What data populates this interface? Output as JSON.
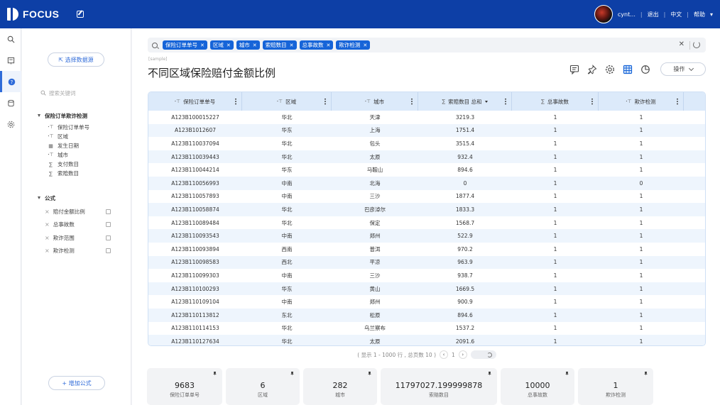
{
  "topbar": {
    "logo_text": "FOCUS",
    "username": "cynt...",
    "logout": "退出",
    "language": "中文",
    "help": "帮助"
  },
  "panel": {
    "select_source": "⇱ 选择数据源",
    "search_placeholder": "搜索关键词",
    "table_name": "保险订单欺诈检测",
    "fields": [
      {
        "icon": "text-field-icon",
        "label": "保险订单单号"
      },
      {
        "icon": "text-field-icon",
        "label": "区域"
      },
      {
        "icon": "date-field-icon",
        "label": "发生日期"
      },
      {
        "icon": "text-field-icon",
        "label": "城市"
      },
      {
        "icon": "number-field-icon",
        "label": "支付数目"
      },
      {
        "icon": "number-field-icon",
        "label": "索赔数目"
      }
    ],
    "formula_header": "公式",
    "formulas": [
      "赔付金额比例",
      "总事故数",
      "欺诈范围",
      "欺诈检测"
    ],
    "add_formula": "+ 增加公式"
  },
  "query": {
    "chips": [
      "保险订单单号",
      "区域",
      "城市",
      "索赔数目",
      "总事故数",
      "欺诈检测"
    ]
  },
  "sample_label": "[sample]",
  "title": "不同区域保险赔付金额比例",
  "toolbar": {
    "tools": [
      "comment-icon",
      "pin-icon",
      "settings-icon",
      "table-icon",
      "pie-chart-icon"
    ],
    "op_button": "操作"
  },
  "table": {
    "columns": [
      {
        "label": "保险订单单号",
        "icon": "ꞏ⊤"
      },
      {
        "label": "区域",
        "icon": "ꞏ⊤"
      },
      {
        "label": "城市",
        "icon": "ꞏ⊤"
      },
      {
        "label": "索赔数目 总和",
        "icon": "∑"
      },
      {
        "label": "总事故数",
        "icon": "∑"
      },
      {
        "label": "欺诈检测",
        "icon": "ꞏ⊤"
      }
    ],
    "rows": [
      [
        "A123B100015227",
        "华北",
        "天津",
        "3219.3",
        "1",
        "1"
      ],
      [
        "A123B1012607",
        "华东",
        "上海",
        "1751.4",
        "1",
        "1"
      ],
      [
        "A123B110037094",
        "华北",
        "包头",
        "3515.4",
        "1",
        "1"
      ],
      [
        "A123B110039443",
        "华北",
        "太原",
        "932.4",
        "1",
        "1"
      ],
      [
        "A123B110044214",
        "华东",
        "马鞍山",
        "894.6",
        "1",
        "1"
      ],
      [
        "A123B110056993",
        "中南",
        "北海",
        "0",
        "1",
        "0"
      ],
      [
        "A123B110057893",
        "中南",
        "三沙",
        "1877.4",
        "1",
        "1"
      ],
      [
        "A123B110058874",
        "华北",
        "巴彦淖尔",
        "1833.3",
        "1",
        "1"
      ],
      [
        "A123B110089484",
        "华北",
        "保定",
        "1568.7",
        "1",
        "1"
      ],
      [
        "A123B110093543",
        "中南",
        "郑州",
        "522.9",
        "1",
        "1"
      ],
      [
        "A123B110093894",
        "西南",
        "普洱",
        "970.2",
        "1",
        "1"
      ],
      [
        "A123B110098583",
        "西北",
        "平凉",
        "963.9",
        "1",
        "1"
      ],
      [
        "A123B110099303",
        "中南",
        "三沙",
        "938.7",
        "1",
        "1"
      ],
      [
        "A123B110100293",
        "华东",
        "黄山",
        "1669.5",
        "1",
        "1"
      ],
      [
        "A123B110109104",
        "中南",
        "郑州",
        "900.9",
        "1",
        "1"
      ],
      [
        "A123B110113812",
        "东北",
        "松原",
        "894.6",
        "1",
        "1"
      ],
      [
        "A123B110114153",
        "华北",
        "乌兰察布",
        "1537.2",
        "1",
        "1"
      ],
      [
        "A123B110127634",
        "华北",
        "太原",
        "2091.6",
        "1",
        "1"
      ]
    ]
  },
  "pager": {
    "summary": "( 显示 1 - 1000 行 , 总页数 10 )",
    "page": "1"
  },
  "cards": [
    {
      "value": "9683",
      "label": "保险订单单号"
    },
    {
      "value": "6",
      "label": "区域"
    },
    {
      "value": "282",
      "label": "城市"
    },
    {
      "value": "11797027.199999878",
      "label": "索赔数目"
    },
    {
      "value": "10000",
      "label": "总事故数"
    },
    {
      "value": "1",
      "label": "欺诈检测"
    }
  ],
  "colors": {
    "topbar": "#0d3fa6",
    "chip": "#1664d8",
    "table_header": "#dceafa",
    "row_alt": "#eef5fd"
  }
}
